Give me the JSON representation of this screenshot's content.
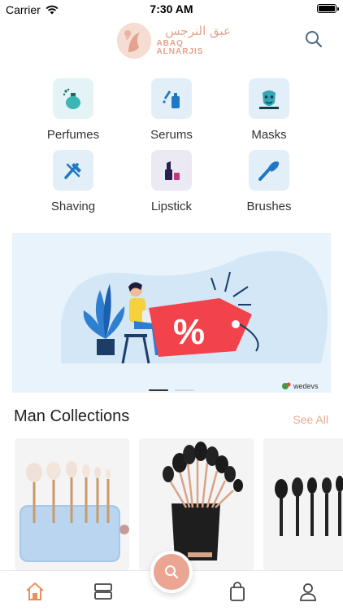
{
  "status_bar": {
    "carrier": "Carrier",
    "time": "7:30 AM"
  },
  "header": {
    "logo_arabic": "عبق النرجس",
    "logo_english": "ABAQ ALNARJIS"
  },
  "categories": [
    {
      "label": "Perfumes",
      "icon": "perfume-icon"
    },
    {
      "label": "Serums",
      "icon": "serum-icon"
    },
    {
      "label": "Masks",
      "icon": "mask-icon"
    },
    {
      "label": "Shaving",
      "icon": "razor-icon"
    },
    {
      "label": "Lipstick",
      "icon": "lipstick-icon"
    },
    {
      "label": "Brushes",
      "icon": "brush-icon"
    }
  ],
  "banner": {
    "badge_text": "%",
    "brand": "wedevs"
  },
  "collections": {
    "title": "Man Collections",
    "see_all_label": "See All"
  },
  "colors": {
    "accent": "#eba593",
    "tile_teal": "#e4f4f6",
    "tile_blue": "#e3eff8",
    "tile_purple": "#ebe9f4",
    "icon_blue": "#1f78c4",
    "badge_red": "#f2424c"
  }
}
